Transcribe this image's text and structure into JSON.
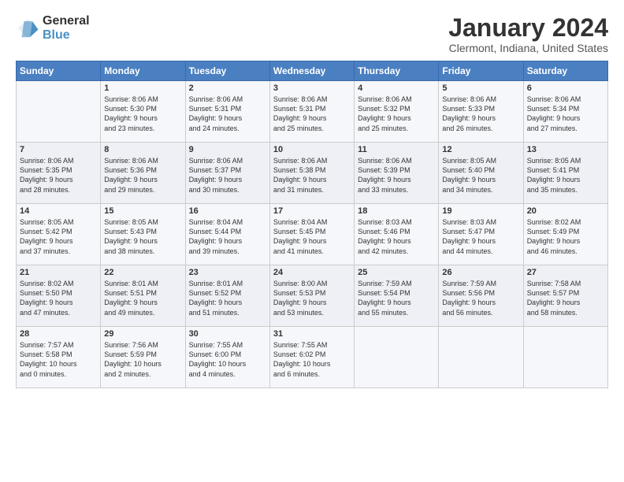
{
  "logo": {
    "general": "General",
    "blue": "Blue"
  },
  "title": "January 2024",
  "subtitle": "Clermont, Indiana, United States",
  "headers": [
    "Sunday",
    "Monday",
    "Tuesday",
    "Wednesday",
    "Thursday",
    "Friday",
    "Saturday"
  ],
  "weeks": [
    [
      {
        "day": "",
        "content": ""
      },
      {
        "day": "1",
        "content": "Sunrise: 8:06 AM\nSunset: 5:30 PM\nDaylight: 9 hours\nand 23 minutes."
      },
      {
        "day": "2",
        "content": "Sunrise: 8:06 AM\nSunset: 5:31 PM\nDaylight: 9 hours\nand 24 minutes."
      },
      {
        "day": "3",
        "content": "Sunrise: 8:06 AM\nSunset: 5:31 PM\nDaylight: 9 hours\nand 25 minutes."
      },
      {
        "day": "4",
        "content": "Sunrise: 8:06 AM\nSunset: 5:32 PM\nDaylight: 9 hours\nand 25 minutes."
      },
      {
        "day": "5",
        "content": "Sunrise: 8:06 AM\nSunset: 5:33 PM\nDaylight: 9 hours\nand 26 minutes."
      },
      {
        "day": "6",
        "content": "Sunrise: 8:06 AM\nSunset: 5:34 PM\nDaylight: 9 hours\nand 27 minutes."
      }
    ],
    [
      {
        "day": "7",
        "content": "Sunrise: 8:06 AM\nSunset: 5:35 PM\nDaylight: 9 hours\nand 28 minutes."
      },
      {
        "day": "8",
        "content": "Sunrise: 8:06 AM\nSunset: 5:36 PM\nDaylight: 9 hours\nand 29 minutes."
      },
      {
        "day": "9",
        "content": "Sunrise: 8:06 AM\nSunset: 5:37 PM\nDaylight: 9 hours\nand 30 minutes."
      },
      {
        "day": "10",
        "content": "Sunrise: 8:06 AM\nSunset: 5:38 PM\nDaylight: 9 hours\nand 31 minutes."
      },
      {
        "day": "11",
        "content": "Sunrise: 8:06 AM\nSunset: 5:39 PM\nDaylight: 9 hours\nand 33 minutes."
      },
      {
        "day": "12",
        "content": "Sunrise: 8:05 AM\nSunset: 5:40 PM\nDaylight: 9 hours\nand 34 minutes."
      },
      {
        "day": "13",
        "content": "Sunrise: 8:05 AM\nSunset: 5:41 PM\nDaylight: 9 hours\nand 35 minutes."
      }
    ],
    [
      {
        "day": "14",
        "content": "Sunrise: 8:05 AM\nSunset: 5:42 PM\nDaylight: 9 hours\nand 37 minutes."
      },
      {
        "day": "15",
        "content": "Sunrise: 8:05 AM\nSunset: 5:43 PM\nDaylight: 9 hours\nand 38 minutes."
      },
      {
        "day": "16",
        "content": "Sunrise: 8:04 AM\nSunset: 5:44 PM\nDaylight: 9 hours\nand 39 minutes."
      },
      {
        "day": "17",
        "content": "Sunrise: 8:04 AM\nSunset: 5:45 PM\nDaylight: 9 hours\nand 41 minutes."
      },
      {
        "day": "18",
        "content": "Sunrise: 8:03 AM\nSunset: 5:46 PM\nDaylight: 9 hours\nand 42 minutes."
      },
      {
        "day": "19",
        "content": "Sunrise: 8:03 AM\nSunset: 5:47 PM\nDaylight: 9 hours\nand 44 minutes."
      },
      {
        "day": "20",
        "content": "Sunrise: 8:02 AM\nSunset: 5:49 PM\nDaylight: 9 hours\nand 46 minutes."
      }
    ],
    [
      {
        "day": "21",
        "content": "Sunrise: 8:02 AM\nSunset: 5:50 PM\nDaylight: 9 hours\nand 47 minutes."
      },
      {
        "day": "22",
        "content": "Sunrise: 8:01 AM\nSunset: 5:51 PM\nDaylight: 9 hours\nand 49 minutes."
      },
      {
        "day": "23",
        "content": "Sunrise: 8:01 AM\nSunset: 5:52 PM\nDaylight: 9 hours\nand 51 minutes."
      },
      {
        "day": "24",
        "content": "Sunrise: 8:00 AM\nSunset: 5:53 PM\nDaylight: 9 hours\nand 53 minutes."
      },
      {
        "day": "25",
        "content": "Sunrise: 7:59 AM\nSunset: 5:54 PM\nDaylight: 9 hours\nand 55 minutes."
      },
      {
        "day": "26",
        "content": "Sunrise: 7:59 AM\nSunset: 5:56 PM\nDaylight: 9 hours\nand 56 minutes."
      },
      {
        "day": "27",
        "content": "Sunrise: 7:58 AM\nSunset: 5:57 PM\nDaylight: 9 hours\nand 58 minutes."
      }
    ],
    [
      {
        "day": "28",
        "content": "Sunrise: 7:57 AM\nSunset: 5:58 PM\nDaylight: 10 hours\nand 0 minutes."
      },
      {
        "day": "29",
        "content": "Sunrise: 7:56 AM\nSunset: 5:59 PM\nDaylight: 10 hours\nand 2 minutes."
      },
      {
        "day": "30",
        "content": "Sunrise: 7:55 AM\nSunset: 6:00 PM\nDaylight: 10 hours\nand 4 minutes."
      },
      {
        "day": "31",
        "content": "Sunrise: 7:55 AM\nSunset: 6:02 PM\nDaylight: 10 hours\nand 6 minutes."
      },
      {
        "day": "",
        "content": ""
      },
      {
        "day": "",
        "content": ""
      },
      {
        "day": "",
        "content": ""
      }
    ]
  ]
}
